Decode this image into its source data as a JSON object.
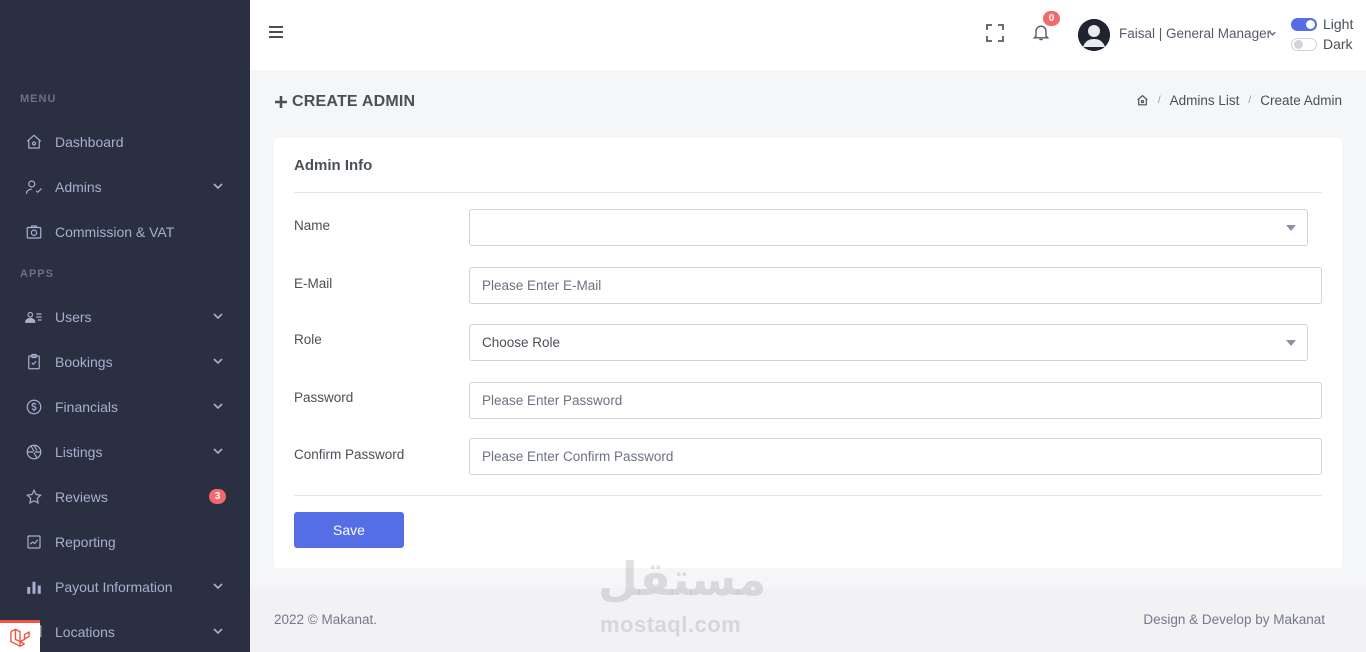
{
  "sidebar": {
    "sections": [
      {
        "title": "MENU"
      },
      {
        "title": "APPS"
      }
    ],
    "items": [
      {
        "label": "Dashboard",
        "icon": "home-icon",
        "has_chevron": false
      },
      {
        "label": "Admins",
        "icon": "user-check-icon",
        "has_chevron": true
      },
      {
        "label": "Commission & VAT",
        "icon": "camera-icon",
        "has_chevron": false
      },
      {
        "label": "Users",
        "icon": "user-list-icon",
        "has_chevron": true
      },
      {
        "label": "Bookings",
        "icon": "clipboard-icon",
        "has_chevron": true
      },
      {
        "label": "Financials",
        "icon": "dollar-circle-icon",
        "has_chevron": true
      },
      {
        "label": "Listings",
        "icon": "aperture-icon",
        "has_chevron": true
      },
      {
        "label": "Reviews",
        "icon": "star-icon",
        "has_chevron": false,
        "badge": "3"
      },
      {
        "label": "Reporting",
        "icon": "line-chart-icon",
        "has_chevron": false
      },
      {
        "label": "Payout Information",
        "icon": "bar-chart-icon",
        "has_chevron": true
      },
      {
        "label": "Locations",
        "icon": "map-icon",
        "has_chevron": true
      }
    ]
  },
  "topbar": {
    "notifications_count": "0",
    "user_label": "Faisal | General Manager",
    "mode_light": "Light",
    "mode_dark": "Dark",
    "light_mode_on": true
  },
  "page": {
    "title": "CREATE ADMIN",
    "breadcrumb": [
      "Admins List",
      "Create Admin"
    ]
  },
  "form": {
    "card_title": "Admin Info",
    "fields": {
      "name": {
        "label": "Name",
        "value": ""
      },
      "email": {
        "label": "E-Mail",
        "placeholder": "Please Enter E-Mail"
      },
      "role": {
        "label": "Role",
        "value": "Choose Role"
      },
      "password": {
        "label": "Password",
        "placeholder": "Please Enter Password"
      },
      "confirm": {
        "label": "Confirm Password",
        "placeholder": "Please Enter Confirm Password"
      }
    },
    "save_label": "Save"
  },
  "footer": {
    "left": "2022 © Makanat.",
    "right": "Design & Develop by Makanat"
  },
  "watermark": {
    "arabic": "مستقل",
    "latin": "mostaql.com"
  },
  "colors": {
    "sidebar_bg": "#2a3042",
    "sidebar_text": "#a6b0cf",
    "primary": "#556ee6",
    "badge": "#f46a6a"
  }
}
